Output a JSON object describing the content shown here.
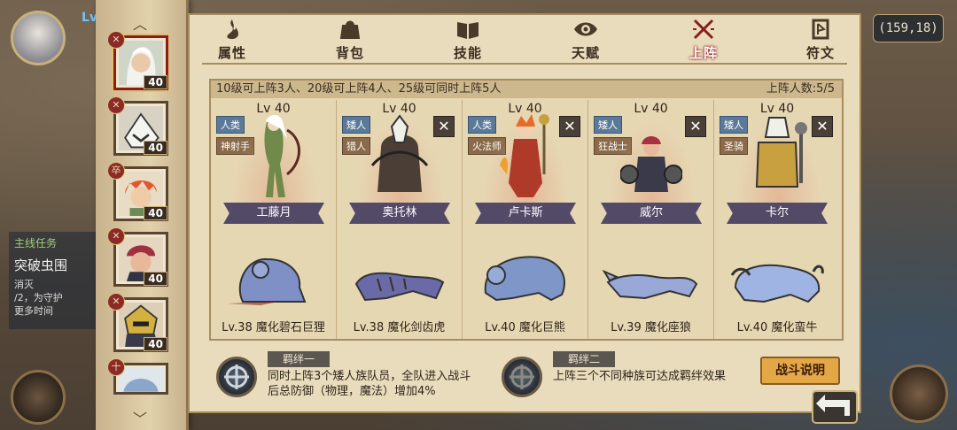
{
  "hud": {
    "level_prefix": "Lv",
    "coordinates": "(159,18)"
  },
  "quest": {
    "title": "主线任务",
    "name": "突破虫围",
    "lines": [
      "消灭",
      "/2，为守护",
      "更多时间"
    ]
  },
  "tabs": [
    {
      "label": "属性",
      "icon": "flame-icon"
    },
    {
      "label": "背包",
      "icon": "bag-icon"
    },
    {
      "label": "技能",
      "icon": "book-icon"
    },
    {
      "label": "天赋",
      "icon": "eye-icon"
    },
    {
      "label": "上阵",
      "icon": "crossed-swords-icon",
      "active": true
    },
    {
      "label": "符文",
      "icon": "rune-icon"
    }
  ],
  "hero_list": [
    {
      "level": "40",
      "badge": "✕",
      "selected": true
    },
    {
      "level": "40",
      "badge": "✕"
    },
    {
      "level": "40",
      "badge": "卒"
    },
    {
      "level": "40",
      "badge": "✕"
    },
    {
      "level": "40",
      "badge": "✕"
    },
    {
      "level": "",
      "badge": "十"
    }
  ],
  "lineup": {
    "rule": "10级可上阵3人、20级可上阵4人、25级可同时上阵5人",
    "count_label": "上阵人数:5/5",
    "slots": [
      {
        "level": "Lv 40",
        "race": "人类",
        "cls": "神射手",
        "name": "工藤月",
        "beast": "Lv.38 魔化碧石巨狸",
        "removable": false
      },
      {
        "level": "Lv 40",
        "race": "矮人",
        "cls": "猎人",
        "name": "奥托林",
        "beast": "Lv.38 魔化剑齿虎",
        "removable": true
      },
      {
        "level": "Lv 40",
        "race": "人类",
        "cls": "火法师",
        "name": "卢卡斯",
        "beast": "Lv.40 魔化巨熊",
        "removable": true
      },
      {
        "level": "Lv 40",
        "race": "矮人",
        "cls": "狂战士",
        "name": "威尔",
        "beast": "Lv.39 魔化座狼",
        "removable": true
      },
      {
        "level": "Lv 40",
        "race": "矮人",
        "cls": "圣骑",
        "name": "卡尔",
        "beast": "Lv.40 魔化蛮牛",
        "removable": true
      }
    ]
  },
  "bonds": [
    {
      "title": "羁绊一",
      "desc_lines": [
        "同时上阵3个矮人族队员，全队进入战斗",
        "后总防御（物理，魔法）增加4%"
      ]
    },
    {
      "title": "羁绊二",
      "desc_lines": [
        "上阵三个不同种族可达成羁绊效果"
      ]
    }
  ],
  "buttons": {
    "battle_info": "战斗说明"
  },
  "colors": {
    "panel_bg": "#e9dcbc",
    "active_tab": "#8a1c1c",
    "battle_btn": "#e3a746"
  }
}
